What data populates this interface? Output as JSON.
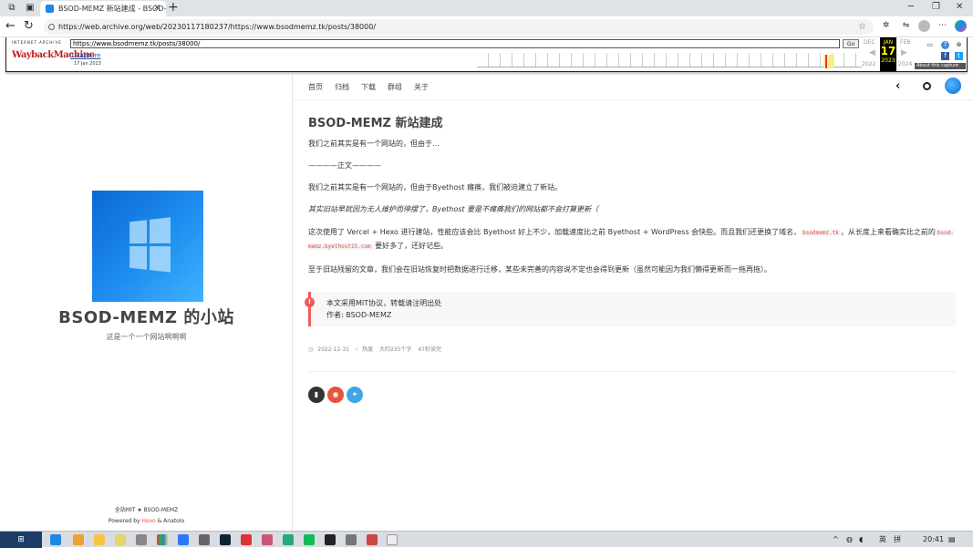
{
  "browser": {
    "tab_title": "BSOD-MEMZ 新站建成 - BSOD-M",
    "url": "https://web.archive.org/web/20230117180237/https://www.bsodmemz.tk/posts/38000/"
  },
  "wayback": {
    "logo_top": "INTERNET ARCHIVE",
    "logo": "WaybackMachine",
    "url": "https://www.bsodmemz.tk/posts/38000/",
    "go_label": "Go",
    "captures": "1 capture",
    "capture_date": "17 Jan 2023",
    "prev_month": "DEC",
    "cur_month": "JAN",
    "cur_day": "17",
    "cur_year": "2023",
    "next_month": "FEB",
    "prev_year": "2022",
    "next_year": "2024",
    "about": "About this capture"
  },
  "sidebar": {
    "title": "BSOD-MEMZ 的小站",
    "subtitle": "这是一个一个网站啊啊啊",
    "footer_line1": "全站MIT ★ BSOD-MEMZ",
    "footer_powered": "Powered by ",
    "footer_hexo": "Hexo",
    "footer_and": " & Anatolo"
  },
  "nav": {
    "items": [
      "首页",
      "归档",
      "下载",
      "群组",
      "关于"
    ]
  },
  "post": {
    "title": "BSOD-MEMZ 新站建成",
    "p1": "我们之前其实是有一个网站的，但由于...",
    "p2": "————正文————",
    "p3": "我们之前其实是有一个网站的，但由于Byethost 瘫痪，我们被迫建立了新站。",
    "p4": "其实旧站早就因为无人维护而停摆了，Byethost 要是不瘫痪我们的网站都不会打算更新（",
    "p5a": "这次使用了 Vercel + Hexo 进行建站，性能应该会比 Byethost 好上不少，加载速度比之前 Byethost + WordPress 会快些。而且我们还更换了域名，",
    "p5_code1": "bsodmemz.tk",
    "p5b": "，从长度上来看确实比之前的",
    "p5_code2": "bsod-memz.byethost15.com",
    "p5c": " 要好多了，还好记些。",
    "p6": "至于旧站残留的文章，我们会在旧站恢复时把数据进行迁移，某些未完善的内容说不定也会得到更新（虽然可能因为我们懒得更新而一拖再拖）。",
    "notice_line1": "本文采用MIT协议，转载请注明出处",
    "notice_line2": "作者: BSOD-MEMZ",
    "meta_date": "2022-12-31",
    "meta_tag": "热度",
    "meta_words": "大约235个字",
    "meta_time": "47秒读完"
  },
  "taskbar": {
    "lang": "英",
    "ime": "拼",
    "time": "20:41"
  }
}
